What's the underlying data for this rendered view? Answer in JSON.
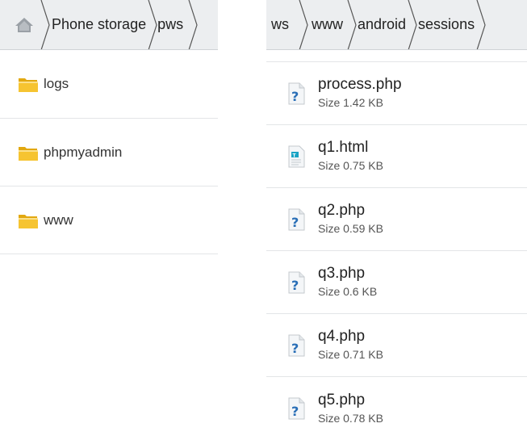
{
  "left": {
    "breadcrumb": [
      "Phone storage",
      "pws"
    ],
    "folders": [
      {
        "label": "logs"
      },
      {
        "label": "phpmyadmin"
      },
      {
        "label": "www"
      }
    ]
  },
  "right": {
    "breadcrumb": [
      "ws",
      "www",
      "android",
      "sessions"
    ],
    "files": [
      {
        "name": "process.php",
        "size": "Size 1.42 KB",
        "icon": "php-file-icon"
      },
      {
        "name": "q1.html",
        "size": "Size 0.75 KB",
        "icon": "html-file-icon"
      },
      {
        "name": "q2.php",
        "size": "Size 0.59 KB",
        "icon": "php-file-icon"
      },
      {
        "name": "q3.php",
        "size": "Size 0.6 KB",
        "icon": "php-file-icon"
      },
      {
        "name": "q4.php",
        "size": "Size 0.71 KB",
        "icon": "php-file-icon"
      },
      {
        "name": "q5.php",
        "size": "Size 0.78 KB",
        "icon": "php-file-icon"
      }
    ]
  },
  "colors": {
    "breadcrumb_bg": "#eceef0",
    "folder_yellow": "#f6c431",
    "php_icon_blue": "#2a6fb7"
  }
}
